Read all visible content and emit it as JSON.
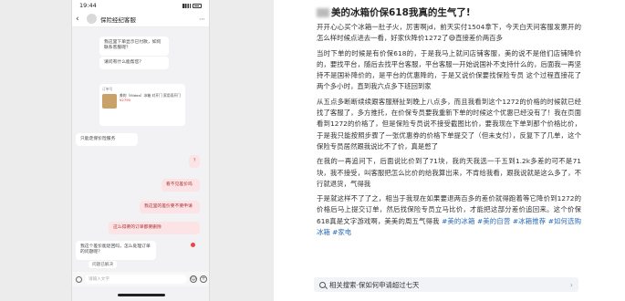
{
  "phone": {
    "status": {
      "time": "19:44"
    },
    "nav": {
      "title": "保险经纪客服"
    },
    "messages": {
      "m1": "我这里下单显示已付款，如何联系客服呢？",
      "m2": "请问有什么能帮您？",
      "m3": "只能走保价险服务",
      "m4": "？",
      "m5": "看不见差价吗",
      "m6": "我这里的差价要不要申请",
      "m7": "这么得要的订单都要删除",
      "m8": "我这个差价能退回吗，怎么处理订单的问题呢？"
    },
    "order": {
      "id_label": "订单号",
      "title": "美的（Midea）冰箱 对开门 家用双开门",
      "price": "¥2790"
    },
    "resolved": "问题已解决",
    "input_placeholder": "请输入文字",
    "colors": {
      "accent": "#e33",
      "bubble_right": "#fce4e6"
    }
  },
  "article": {
    "title": "美的冰箱价保618我真的生气了!",
    "paragraphs": [
      "开开心心买个冰箱一肚子火，厉害啊jd，前天实付1504拿下，今天白天问客服发票开的怎么样时候点进去一看，好家伙降价1272了😅直接差价两百多",
      "当时下单的时候是有价保618的，于是我马上就问店铺客服，美的说不是他们店铺降价的，要找平台，随后去找平台客服，平台客服一开始说国补不支持什么的，后面我一再坚持不是国补降价的，是平台的优惠降的，于是又说价保要找保险专员  这个过程直接花了两个多小时，直到我六点多下班回到家",
      "从五点多断断续续跟客服掰扯到晚上八点多，而且我看到这个1272的价格的时候就已经找了客服了，多方推托，在价保专员要我重新下单的时候这个优惠已经没有了！我在页面看到1272的价格了，但是保险专员说不接受截图比价，要我现在下单到那个价格比价，于是我只能按照步骤了一张优惠券的价格下单提交了（但未支付），反复下了几单，这个保险专员居然跟我说比不了价，真是憋了",
      "在我的一再追问下，后面说比价到了71块，我的天我选一千五到1.2k多差的可不是71块，我不接受，叫客服把怎么比价的给我算出来，不肯给我看，跟我说就是这么多了，不行就退货，气得我",
      "于是就这样不了了之，相当于我现在如果要退两百多的差价就得跑着等它降价到1272的价格后马上提交订单，然后找保险专员立马比价，才能把这部分差价追回来。这个价保618真是文字游戏啊，美美的周五气得我 #美的冰箱 #美的自营 #冰箱推荐 #如何选购冰箱 #家电"
    ],
    "search": {
      "prefix": "相关搜索·",
      "text": "保如何申请超过七天"
    }
  }
}
